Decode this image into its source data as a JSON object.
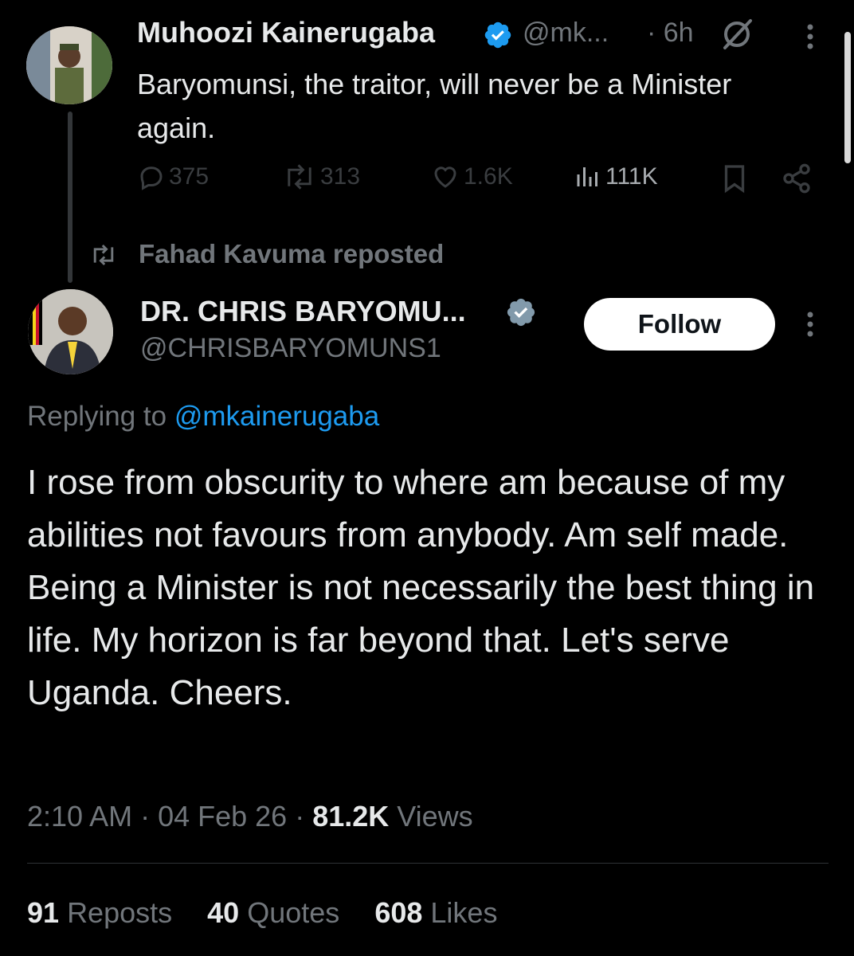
{
  "parent_tweet": {
    "author_name": "Muhoozi Kainerugaba",
    "handle": "@mk...",
    "time": "· 6h",
    "text": "Baryomunsi, the traitor, will never be a Minister again.",
    "replies": "375",
    "reposts": "313",
    "likes": "1.6K",
    "views": "111K"
  },
  "repost_context": {
    "label": "Fahad Kavuma reposted"
  },
  "main_tweet": {
    "author_name": "DR. CHRIS BARYOMU...",
    "handle": "@CHRISBARYOMUNS1",
    "follow_label": "Follow",
    "replying_prefix": "Replying to",
    "replying_mention": "@mkainerugaba",
    "text": "I rose from obscurity to where am because of my abilities not favours from anybody. Am self made.  Being a Minister is not necessarily the best thing in life. My horizon is far beyond that. Let's serve Uganda. Cheers.",
    "timestamp": "2:10 AM · 04 Feb 26 ·",
    "views_count": "81.2K",
    "views_label": "Views",
    "stats": {
      "reposts_count": "91",
      "reposts_label": "Reposts",
      "quotes_count": "40",
      "quotes_label": "Quotes",
      "likes_count": "608",
      "likes_label": "Likes"
    }
  },
  "colors": {
    "background": "#000000",
    "text": "#e7e9ea",
    "muted": "#71767b",
    "link": "#1d9bf0",
    "verified": "#1d9bf0"
  },
  "icons": [
    "verified-badge-icon",
    "grok-icon",
    "more-icon",
    "reply-icon",
    "retweet-icon",
    "like-icon",
    "views-icon",
    "bookmark-icon",
    "share-icon",
    "repost-icon"
  ]
}
